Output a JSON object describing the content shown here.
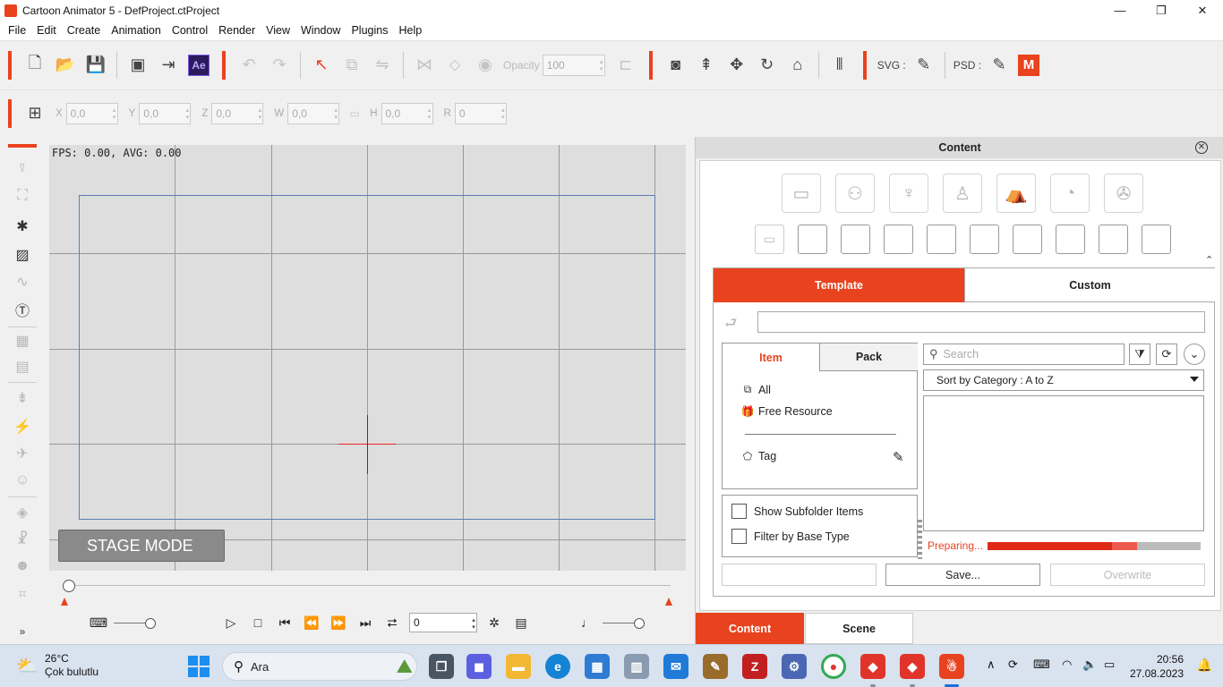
{
  "window": {
    "title": "Cartoon Animator 5 - DefProject.ctProject",
    "minimize": "—",
    "restore": "❐",
    "close": "✕"
  },
  "menu": [
    "File",
    "Edit",
    "Create",
    "Animation",
    "Control",
    "Render",
    "View",
    "Window",
    "Plugins",
    "Help"
  ],
  "toolbar1": {
    "ae_label": "Ae",
    "opacity_label": "Opacity",
    "opacity_value": "100",
    "svg_label": "SVG :",
    "psd_label": "PSD :",
    "m_label": "M"
  },
  "toolbar2": {
    "x_label": "X",
    "x_value": "0,0",
    "y_label": "Y",
    "y_value": "0,0",
    "z_label": "Z",
    "z_value": "0,0",
    "w_label": "W",
    "w_value": "0,0",
    "h_label": "H",
    "h_value": "0,0",
    "r_label": "R",
    "r_value": "0"
  },
  "stage": {
    "fps_text": "FPS: 0.00, AVG: 0.00",
    "mode_label": "STAGE MODE"
  },
  "timeline": {
    "frame_value": "0",
    "more": "»"
  },
  "content_panel": {
    "title": "Content",
    "tabs": {
      "template": "Template",
      "custom": "Custom"
    },
    "item_tabs": {
      "item": "Item",
      "pack": "Pack"
    },
    "tree": {
      "all": "All",
      "free_resource": "Free Resource",
      "tag": "Tag"
    },
    "search_placeholder": "Search",
    "sort_value": "Sort by Category : A to Z",
    "options": {
      "show_subfolder": "Show Subfolder Items",
      "filter_base_type": "Filter by Base Type"
    },
    "status_text": "Preparing...",
    "progress": 0.7,
    "buttons": {
      "save": "Save...",
      "overwrite": "Overwrite"
    },
    "bottom_tabs": {
      "content": "Content",
      "scene": "Scene"
    }
  },
  "taskbar": {
    "weather_temp": "26°C",
    "weather_desc": "Çok bulutlu",
    "search_label": "Ara",
    "time": "20:56",
    "date": "27.08.2023"
  },
  "colors": {
    "accent": "#e8431e",
    "frame_border": "#5a7fb0",
    "stage_bg": "#dedede"
  }
}
